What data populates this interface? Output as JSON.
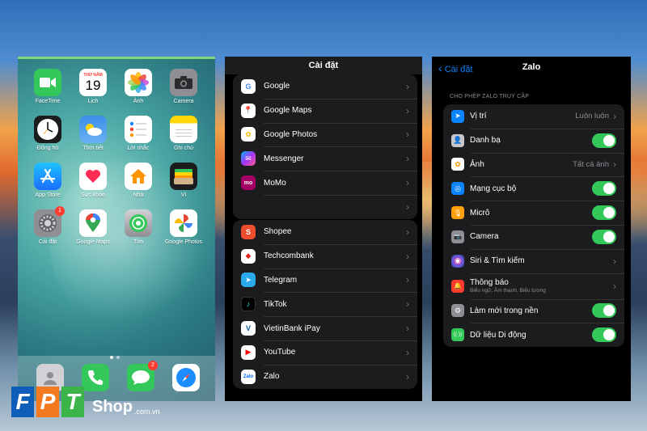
{
  "home": {
    "apps": [
      {
        "label": "FaceTime",
        "icon": "facetime-icon",
        "color": "#34c759"
      },
      {
        "label": "Lịch",
        "icon": "calendar-icon",
        "color": "#ffffff",
        "month": "THỨ NĂM",
        "day": "19"
      },
      {
        "label": "Ảnh",
        "icon": "photos-icon",
        "color": "#ffffff"
      },
      {
        "label": "Camera",
        "icon": "camera-icon",
        "color": "#8e8e93"
      },
      {
        "label": "Đồng hồ",
        "icon": "clock-icon",
        "color": "#1c1c1e"
      },
      {
        "label": "Thời tiết",
        "icon": "weather-icon",
        "color": "#3a8ee6"
      },
      {
        "label": "Lời nhắc",
        "icon": "reminders-icon",
        "color": "#ffffff"
      },
      {
        "label": "Ghi chú",
        "icon": "notes-icon",
        "color": "#ffd60a"
      },
      {
        "label": "App Store",
        "icon": "app-store-icon",
        "color": "#1a8cff"
      },
      {
        "label": "Sức khỏe",
        "icon": "health-icon",
        "color": "#ffffff"
      },
      {
        "label": "Nhà",
        "icon": "home-icon",
        "color": "#ffffff"
      },
      {
        "label": "Ví",
        "icon": "wallet-icon",
        "color": "#1c1c1e"
      },
      {
        "label": "Cài đặt",
        "icon": "settings-icon",
        "color": "#8e8e93",
        "badge": "1"
      },
      {
        "label": "Google Maps",
        "icon": "google-maps-icon",
        "color": "#ffffff"
      },
      {
        "label": "Tìm",
        "icon": "find-my-icon",
        "color": "#34c759"
      },
      {
        "label": "Google Photos",
        "icon": "google-photos-icon",
        "color": "#ffffff"
      }
    ],
    "dock": [
      {
        "icon": "contacts-icon",
        "color": "#d1d1d6"
      },
      {
        "icon": "phone-icon",
        "color": "#34c759"
      },
      {
        "icon": "messages-icon",
        "color": "#34c759",
        "badge": "2"
      },
      {
        "icon": "safari-icon",
        "color": "#ffffff"
      }
    ]
  },
  "logo": {
    "fpt": [
      "F",
      "P",
      "T"
    ],
    "shop": "Shop",
    "domain": ".com.vn"
  },
  "settings_list": {
    "title": "Cài đặt",
    "group1": [
      {
        "label": "Google",
        "icon": "google-icon",
        "color": "#ffffff",
        "glyph": "G"
      },
      {
        "label": "Google Maps",
        "icon": "google-maps-icon",
        "color": "#ffffff",
        "glyph": "📍"
      },
      {
        "label": "Google Photos",
        "icon": "google-photos-icon",
        "color": "#ffffff",
        "glyph": "✿"
      },
      {
        "label": "Messenger",
        "icon": "messenger-icon",
        "color": "#a334fa",
        "glyph": "✉"
      },
      {
        "label": "MoMo",
        "icon": "momo-icon",
        "color": "#a50064",
        "glyph": "mo"
      },
      {
        "label": "",
        "icon": "",
        "color": "#1c1c1e",
        "glyph": ""
      }
    ],
    "group2": [
      {
        "label": "Shopee",
        "icon": "shopee-icon",
        "color": "#ee4d2d",
        "glyph": "S"
      },
      {
        "label": "Techcombank",
        "icon": "techcombank-icon",
        "color": "#ffffff",
        "glyph": "◆"
      },
      {
        "label": "Telegram",
        "icon": "telegram-icon",
        "color": "#2aabee",
        "glyph": "➤"
      },
      {
        "label": "TikTok",
        "icon": "tiktok-icon",
        "color": "#000000",
        "glyph": "♪"
      },
      {
        "label": "VietinBank iPay",
        "icon": "vietinbank-icon",
        "color": "#ffffff",
        "glyph": "V"
      },
      {
        "label": "YouTube",
        "icon": "youtube-icon",
        "color": "#ffffff",
        "glyph": "▶"
      },
      {
        "label": "Zalo",
        "icon": "zalo-icon",
        "color": "#ffffff",
        "glyph": "Zalo"
      }
    ]
  },
  "zalo": {
    "back_label": "Cài đặt",
    "title": "Zalo",
    "section": "CHO PHÉP ZALO TRUY CẬP",
    "rows": [
      {
        "label": "Vị trí",
        "value": "Luôn luôn",
        "type": "nav",
        "icon": "location-icon",
        "color": "#0a84ff",
        "glyph": "➤"
      },
      {
        "label": "Danh bạ",
        "type": "toggle",
        "icon": "contacts-icon",
        "color": "#c7c7cc",
        "glyph": "👤"
      },
      {
        "label": "Ảnh",
        "value": "Tất cả ảnh",
        "type": "nav",
        "icon": "photos-icon",
        "color": "#ffffff",
        "glyph": "✿"
      },
      {
        "label": "Mạng cục bộ",
        "type": "toggle",
        "icon": "globe-icon",
        "color": "#0a84ff",
        "glyph": "◎"
      },
      {
        "label": "Micrô",
        "type": "toggle",
        "icon": "microphone-icon",
        "color": "#ff9f0a",
        "glyph": "🎙"
      },
      {
        "label": "Camera",
        "type": "toggle",
        "icon": "camera-icon",
        "color": "#8e8e93",
        "glyph": "📷"
      },
      {
        "label": "Siri & Tìm kiếm",
        "type": "nav",
        "icon": "siri-icon",
        "color": "#1c1c1e",
        "glyph": "◉"
      },
      {
        "label": "Thông báo",
        "sub": "Biểu ngữ, Âm thanh, Biểu tượng",
        "type": "nav",
        "icon": "notifications-icon",
        "color": "#ff3b30",
        "glyph": "🔔"
      },
      {
        "label": "Làm mới trong nền",
        "type": "toggle",
        "icon": "gear-icon",
        "color": "#8e8e93",
        "glyph": "⚙"
      },
      {
        "label": "Dữ liệu Di động",
        "type": "toggle",
        "icon": "cellular-icon",
        "color": "#34c759",
        "glyph": "((·))"
      }
    ]
  },
  "colors": {
    "accent": "#0a84ff",
    "toggle_on": "#34c759"
  }
}
